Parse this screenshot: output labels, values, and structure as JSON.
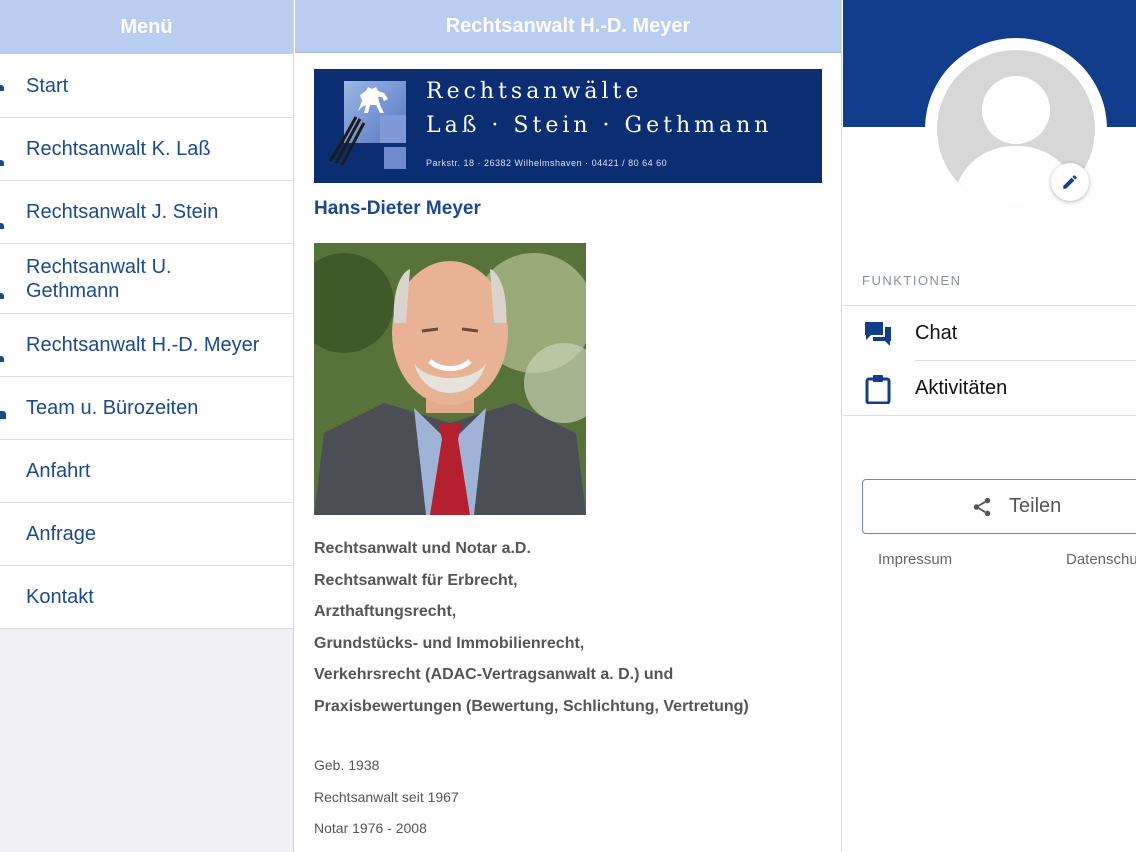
{
  "menu": {
    "title": "Menü",
    "items": [
      {
        "label": "Start"
      },
      {
        "label": "Rechtsanwalt K. Laß"
      },
      {
        "label": "Rechtsanwalt J. Stein"
      },
      {
        "label": "Rechtsanwalt U. Gethmann"
      },
      {
        "label": "Rechtsanwalt H.-D. Meyer"
      },
      {
        "label": "Team u. Bürozeiten"
      },
      {
        "label": "Anfahrt"
      },
      {
        "label": "Anfrage"
      },
      {
        "label": "Kontakt"
      }
    ]
  },
  "content": {
    "title": "Rechtsanwalt H.-D. Meyer",
    "banner": {
      "line1": "Rechtsanwälte",
      "line2": "Laß · Stein · Gethmann",
      "address": "Parkstr. 18 · 26382 Wilhelmshaven · 04421 / 80 64 60"
    },
    "person_name": "Hans-Dieter Meyer",
    "description": [
      "Rechtsanwalt und Notar a.D.",
      "Rechtsanwalt für Erbrecht,",
      "Arzthaftungsrecht,",
      "Grundstücks- und Immobilienrecht,",
      "Verkehrsrecht (ADAC-Vertragsanwalt a. D.) und",
      "Praxisbewertungen (Bewertung, Schlichtung, Vertretung)"
    ],
    "facts": [
      "Geb. 1938",
      "Rechtsanwalt seit 1967",
      "Notar 1976 - 2008"
    ]
  },
  "sidebar_right": {
    "section_label": "FUNKTIONEN",
    "functions": [
      {
        "label": "Chat",
        "icon": "chat-icon"
      },
      {
        "label": "Aktivitäten",
        "icon": "clipboard-icon"
      }
    ],
    "share_label": "Teilen",
    "footer_links": [
      "Impressum",
      "Datenschu"
    ]
  },
  "colors": {
    "header_bg": "#b8cdf0",
    "brand_blue": "#123d8c",
    "link_blue": "#1a4a8c",
    "banner_bg": "#0b2e72"
  }
}
